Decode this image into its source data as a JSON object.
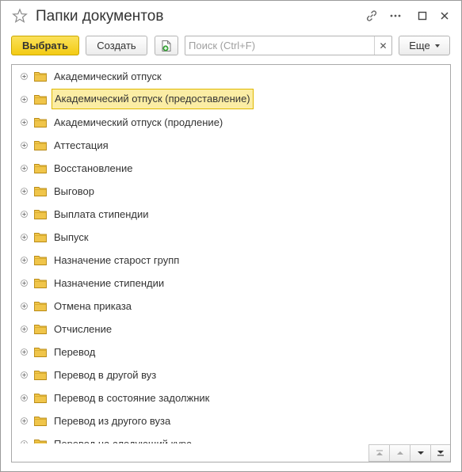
{
  "window": {
    "title": "Папки документов"
  },
  "toolbar": {
    "select_label": "Выбрать",
    "create_label": "Создать",
    "more_label": "Еще"
  },
  "search": {
    "placeholder": "Поиск (Ctrl+F)",
    "value": ""
  },
  "colors": {
    "primary_button": "#f3cb13",
    "selected_row": "#fbeda4",
    "selected_border": "#e0b800",
    "folder": "#f0c54a"
  },
  "tree": {
    "selected_index": 1,
    "items": [
      {
        "label": "Академический отпуск"
      },
      {
        "label": "Академический отпуск (предоставление)"
      },
      {
        "label": "Академический отпуск (продление)"
      },
      {
        "label": "Аттестация"
      },
      {
        "label": "Восстановление"
      },
      {
        "label": "Выговор"
      },
      {
        "label": "Выплата стипендии"
      },
      {
        "label": "Выпуск"
      },
      {
        "label": "Назначение старост групп"
      },
      {
        "label": "Назначение стипендии"
      },
      {
        "label": "Отмена приказа"
      },
      {
        "label": "Отчисление"
      },
      {
        "label": "Перевод"
      },
      {
        "label": "Перевод в другой вуз"
      },
      {
        "label": "Перевод в состояние задолжник"
      },
      {
        "label": "Перевод из другого вуза"
      },
      {
        "label": "Перевод на следующий курс"
      }
    ]
  }
}
